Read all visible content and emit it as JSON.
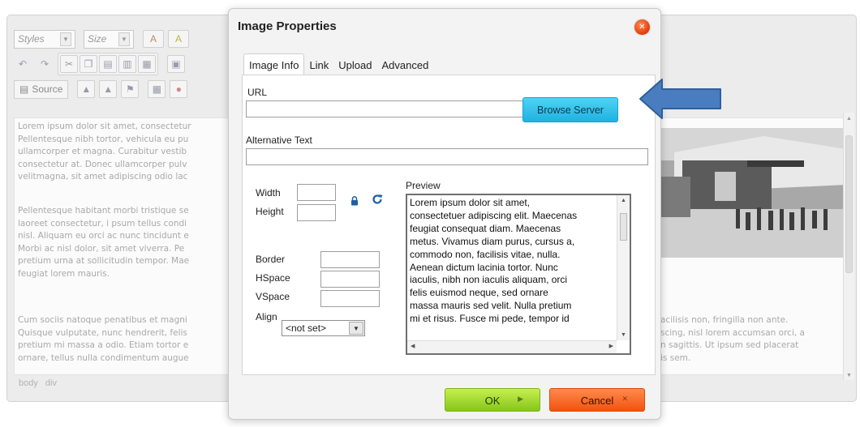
{
  "editor": {
    "toolbar": {
      "styles_combo": "Styles",
      "size_combo": "Size",
      "source_button": "Source"
    },
    "content": {
      "para1": "Lorem ipsum dolor sit amet, consectetur\nPellentesque nibh tortor, vehicula eu pu\nullamcorper et magna. Curabitur vestib\nconsectetur at. Donec ullamcorper pulv\nvelitmagna, sit amet adipiscing odio lac",
      "para2": "Pellentesque habitant morbi tristique se\nlaoreet consectetur, i psum tellus condi\nnisl. Aliquam eu orci ac nunc tincidunt e\nMorbi ac nisl dolor, sit amet viverra. Pe\npretium urna at sollicitudin tempor. Mae\nfeugiat lorem mauris.",
      "para3": "Cum sociis natoque penatibus et magni\nQuisque vulputate, nunc hendrerit, felis\npretium mi massa a odio. Etiam tortor e\nornare, tellus nulla condimentum augue",
      "right_text": "acilisis non, fringilla non ante.\nscing, nisl lorem accumsan orci, a\nn sagittis. Ut ipsum sed placerat\nis sem."
    },
    "elements_path": "body div"
  },
  "dialog": {
    "title": "Image Properties",
    "tabs": [
      {
        "label": "Image Info",
        "active": true
      },
      {
        "label": "Link",
        "active": false
      },
      {
        "label": "Upload",
        "active": false
      },
      {
        "label": "Advanced",
        "active": false
      }
    ],
    "url_label": "URL",
    "url_value": "",
    "browse_server_label": "Browse Server",
    "alt_text_label": "Alternative Text",
    "alt_text_value": "",
    "width_label": "Width",
    "height_label": "Height",
    "border_label": "Border",
    "hspace_label": "HSpace",
    "vspace_label": "VSpace",
    "align_label": "Align",
    "align_value": "<not set>",
    "preview_label": "Preview",
    "preview_text": "Lorem ipsum dolor sit amet,\nconsectetuer adipiscing elit. Maecenas\nfeugiat consequat diam. Maecenas\nmetus. Vivamus diam purus, cursus a,\ncommodo non, facilisis vitae, nulla.\nAenean dictum lacinia tortor. Nunc\niaculis, nibh non iaculis aliquam, orci\nfelis euismod neque, sed ornare\nmassa mauris sed velit. Nulla pretium\nmi et risus. Fusce mi pede, tempor id",
    "ok_label": "OK",
    "cancel_label": "Cancel"
  },
  "colors": {
    "browse_button": "#1fb2e1",
    "ok_button": "#86c51a",
    "cancel_button": "#f2530f",
    "close_button": "#e23b0c",
    "annotation_arrow": "#4a7dbf"
  },
  "icons": [
    "lock-icon",
    "reset-size-icon",
    "close-icon",
    "undo-icon",
    "redo-icon",
    "source-icon"
  ]
}
